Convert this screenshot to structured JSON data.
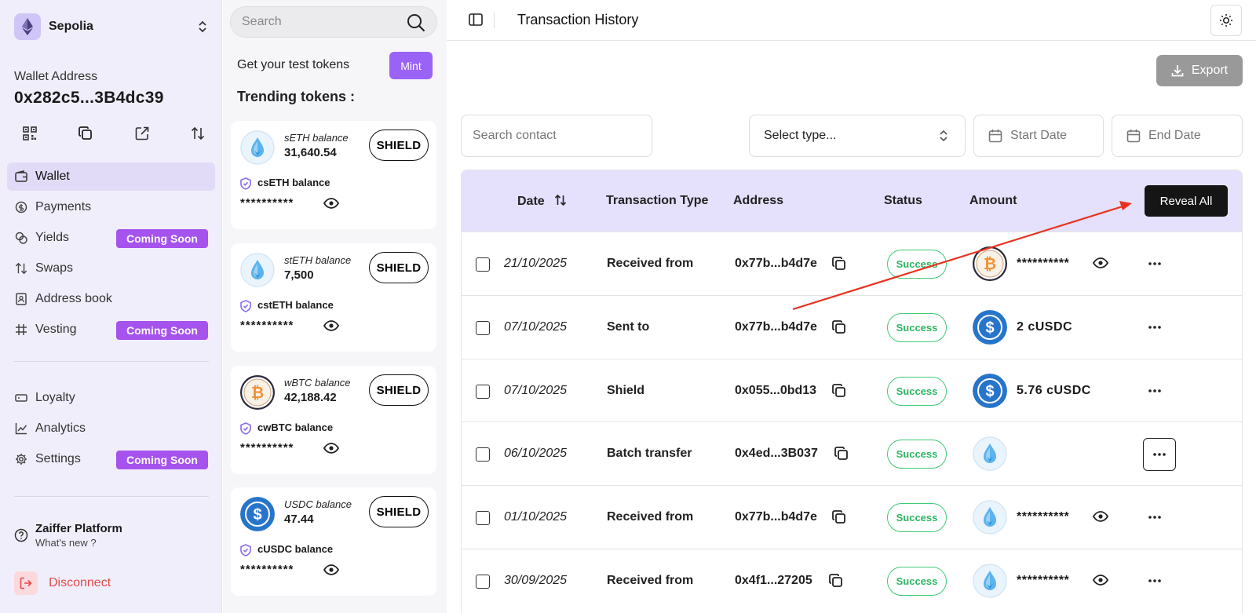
{
  "network": {
    "name": "Sepolia"
  },
  "wallet": {
    "label": "Wallet Address",
    "address": "0x282c5...3B4dc39"
  },
  "wallet_actions": [
    "qr-code-icon",
    "copy-icon",
    "external-link-icon",
    "swap-arrows-icon"
  ],
  "nav": {
    "main": [
      {
        "label": "Wallet",
        "icon": "wallet-icon",
        "active": true
      },
      {
        "label": "Payments",
        "icon": "payments-icon"
      },
      {
        "label": "Yields",
        "icon": "coins-icon",
        "badge": "Coming Soon"
      },
      {
        "label": "Swaps",
        "icon": "swap-arrows-icon"
      },
      {
        "label": "Address book",
        "icon": "address-book-icon"
      },
      {
        "label": "Vesting",
        "icon": "vesting-icon",
        "badge": "Coming Soon"
      }
    ],
    "secondary": [
      {
        "label": "Loyalty",
        "icon": "ticket-icon"
      },
      {
        "label": "Analytics",
        "icon": "chart-icon"
      },
      {
        "label": "Settings",
        "icon": "gear-icon",
        "badge": "Coming Soon"
      }
    ]
  },
  "platform": {
    "title": "Zaiffer Platform",
    "subtitle": "What's new ?"
  },
  "disconnect_label": "Disconnect",
  "tokens_panel": {
    "search_placeholder": "Search",
    "get_tokens": "Get your test tokens",
    "mint_label": "Mint",
    "trending_title": "Trending tokens :",
    "shield_label": "SHIELD",
    "cards": [
      {
        "name": "sETH balance",
        "value": "31,640.54",
        "confidential_name": "csETH balance",
        "masked": "**********",
        "logo": "eth"
      },
      {
        "name": "stETH balance",
        "value": "7,500",
        "confidential_name": "cstETH balance",
        "masked": "**********",
        "logo": "eth"
      },
      {
        "name": "wBTC balance",
        "value": "42,188.42",
        "confidential_name": "cwBTC balance",
        "masked": "**********",
        "logo": "btc"
      },
      {
        "name": "USDC balance",
        "value": "47.44",
        "confidential_name": "cUSDC balance",
        "masked": "**********",
        "logo": "usdc"
      }
    ]
  },
  "main": {
    "title": "Transaction History",
    "export_label": "Export",
    "search_contact_placeholder": "Search contact",
    "select_type": "Select type...",
    "start_date": "Start Date",
    "end_date": "End Date",
    "columns": {
      "date": "Date",
      "type": "Transaction Type",
      "address": "Address",
      "status": "Status",
      "amount": "Amount"
    },
    "reveal_all": "Reveal All",
    "rows": [
      {
        "date": "21/10/2025",
        "type": "Received from",
        "address": "0x77b...b4d7e",
        "status": "Success",
        "token": "btc",
        "amount": "**********",
        "masked": true
      },
      {
        "date": "07/10/2025",
        "type": "Sent to",
        "address": "0x77b...b4d7e",
        "status": "Success",
        "token": "usdc",
        "amount": "2 cUSDC",
        "masked": false
      },
      {
        "date": "07/10/2025",
        "type": "Shield",
        "address": "0x055...0bd13",
        "status": "Success",
        "token": "usdc",
        "amount": "5.76 cUSDC",
        "masked": false
      },
      {
        "date": "06/10/2025",
        "type": "Batch transfer",
        "address": "0x4ed...3B037",
        "status": "Success",
        "token": "eth",
        "amount": "",
        "masked": false
      },
      {
        "date": "01/10/2025",
        "type": "Received from",
        "address": "0x77b...b4d7e",
        "status": "Success",
        "token": "eth",
        "amount": "**********",
        "masked": true
      },
      {
        "date": "30/09/2025",
        "type": "Received from",
        "address": "0x4f1...27205",
        "status": "Success",
        "token": "eth",
        "amount": "**********",
        "masked": true
      }
    ]
  },
  "colors": {
    "accent": "#a653ee",
    "success": "#2db561",
    "annotation_arrow": "#e8321f"
  }
}
